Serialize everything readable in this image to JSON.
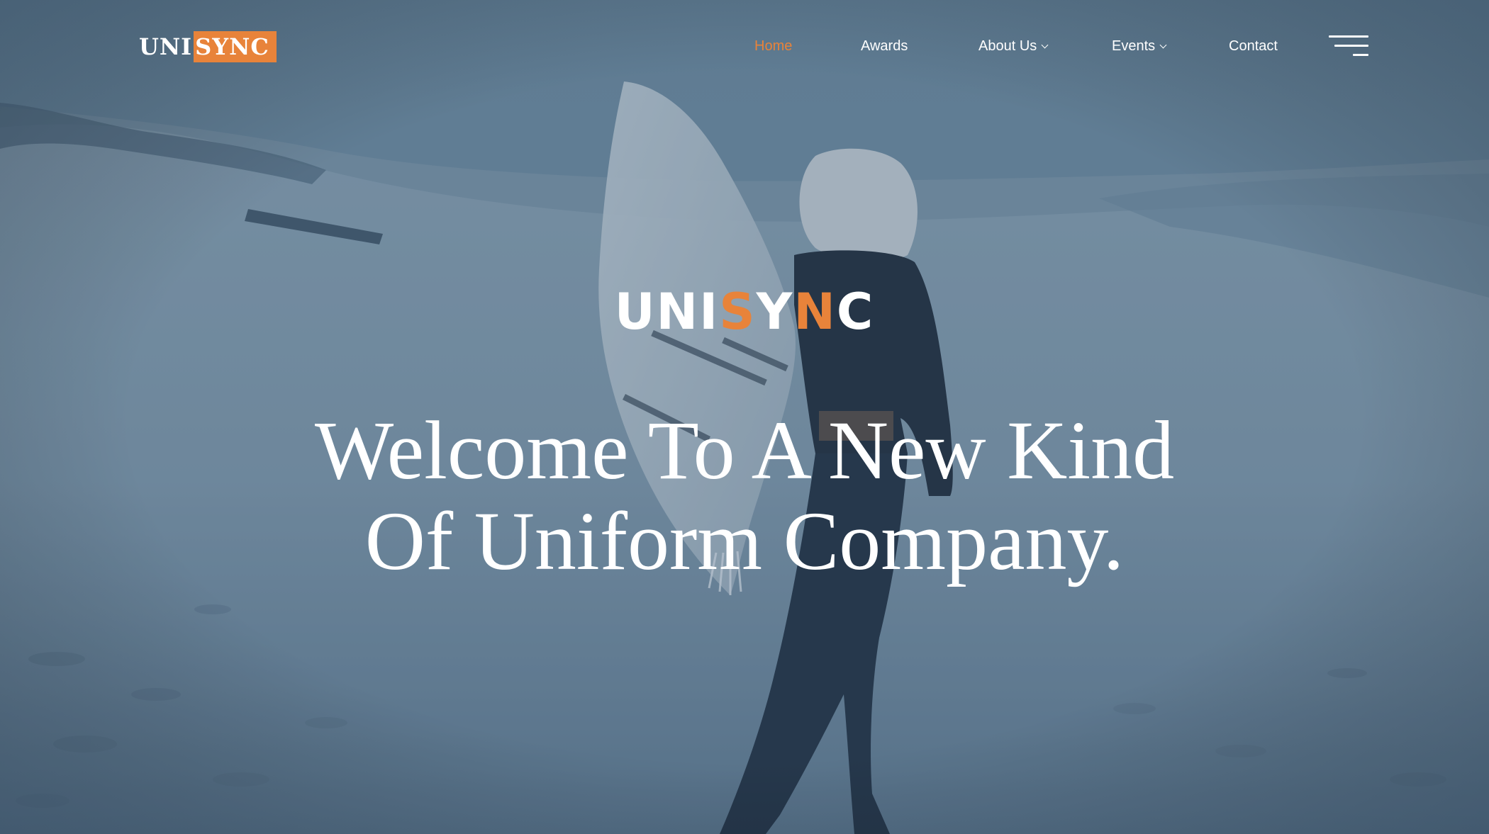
{
  "brand": {
    "logo_part_a": "UNI",
    "logo_part_b": "SYNC",
    "hero_part_a": "UNI",
    "hero_part_b": "S",
    "hero_part_c": "Y",
    "hero_part_d": "N",
    "hero_part_e": "C"
  },
  "nav": {
    "items": [
      {
        "label": "Home",
        "active": true
      },
      {
        "label": "Awards"
      },
      {
        "label": "About Us",
        "dropdown": true
      },
      {
        "label": "Events",
        "dropdown": true
      },
      {
        "label": "Contact"
      }
    ],
    "menu_icon": "hamburger-menu-icon"
  },
  "hero": {
    "headline_line1": "Welcome To A New Kind",
    "headline_line2": "Of Uniform Company."
  },
  "colors": {
    "accent": "#e8833a",
    "overlay": "#4f6c86",
    "text": "#ffffff"
  }
}
